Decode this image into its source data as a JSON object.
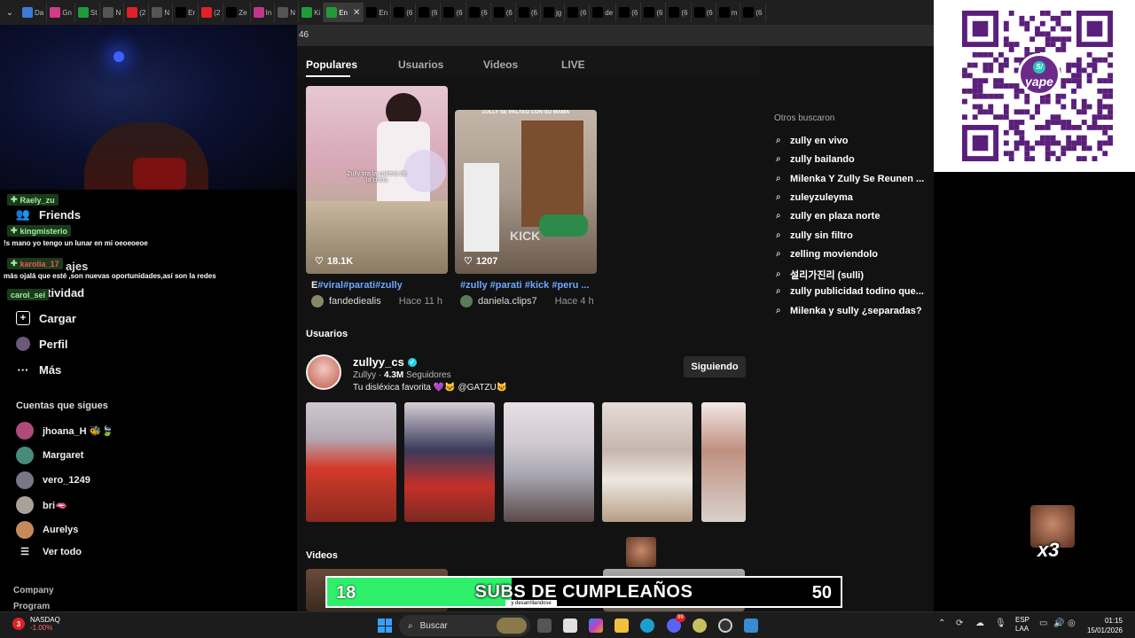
{
  "browser": {
    "tabs": [
      {
        "label": "Da",
        "color": "#3a7bd5"
      },
      {
        "label": "Gn",
        "color": "#d23a8a"
      },
      {
        "label": "St",
        "color": "#1e9c3a"
      },
      {
        "label": "N",
        "color": "#555555"
      },
      {
        "label": "(2",
        "color": "#e0202a"
      },
      {
        "label": "N",
        "color": "#555555"
      },
      {
        "label": "Er",
        "color": "#000000"
      },
      {
        "label": "(2",
        "color": "#e0202a"
      },
      {
        "label": "Ze",
        "color": "#000000"
      },
      {
        "label": "In",
        "color": "#c1358a"
      },
      {
        "label": "N",
        "color": "#555555"
      },
      {
        "label": "Ki",
        "color": "#1e9c3a"
      },
      {
        "label": "En",
        "color": "#1e9c3a"
      },
      {
        "label": "En",
        "color": "#000000"
      },
      {
        "label": "(6",
        "color": "#000000"
      },
      {
        "label": "(6",
        "color": "#000000"
      },
      {
        "label": "(6",
        "color": "#000000"
      },
      {
        "label": "(6",
        "color": "#000000"
      },
      {
        "label": "(6",
        "color": "#000000"
      },
      {
        "label": "(6",
        "color": "#000000"
      },
      {
        "label": "jg",
        "color": "#000000"
      },
      {
        "label": "(6",
        "color": "#000000"
      },
      {
        "label": "de",
        "color": "#000000"
      },
      {
        "label": "(6",
        "color": "#000000"
      },
      {
        "label": "(6",
        "color": "#000000"
      },
      {
        "label": "(6",
        "color": "#000000"
      },
      {
        "label": "(6",
        "color": "#000000"
      },
      {
        "label": "m",
        "color": "#000000"
      },
      {
        "label": "(6",
        "color": "#000000"
      }
    ],
    "active_tab_index": 12,
    "address_fragment": "46"
  },
  "sidebar": {
    "nav": [
      {
        "label": "Friends",
        "icon": "friends-icon",
        "glyph": "👥"
      },
      {
        "label": "Cargar",
        "icon": "upload-icon",
        "glyph": "⊞"
      },
      {
        "label": "Perfil",
        "icon": "profile-icon",
        "glyph": "●"
      },
      {
        "label": "Más",
        "icon": "more-icon",
        "glyph": "···"
      }
    ],
    "partial_labels": [
      "ajes",
      "ctividad"
    ],
    "following_title": "Cuentas que sigues",
    "following": [
      {
        "name": "jhoana_H 🐝🍃",
        "color": "#b04a7a"
      },
      {
        "name": "Margaret",
        "color": "#4a8a7a"
      },
      {
        "name": "vero_1249",
        "color": "#777788"
      },
      {
        "name": "bri🫦",
        "color": "#aaa09a"
      },
      {
        "name": "Aurelys",
        "color": "#c58a5a"
      },
      {
        "name": "Ver todo",
        "color": ""
      }
    ],
    "footer": [
      "Company",
      "Program"
    ]
  },
  "chat": [
    {
      "user": "Raely_zu",
      "color": "#5bd65b",
      "message": ""
    },
    {
      "user": "kingmisterio",
      "color": "#5bd65b",
      "message": "!s mano yo tengo un lunar en mi oeoeoeoe"
    },
    {
      "user": "karolia_17",
      "color": "#e85a5a",
      "message": "más ojalá que esté ,son nuevas oportunidades,así son la redes"
    },
    {
      "user": "carol_sei",
      "color": "#5bd65b",
      "message": ""
    }
  ],
  "main": {
    "tabs": [
      "Populares",
      "Usuarios",
      "Videos",
      "LIVE"
    ],
    "active_tab": "Populares",
    "videos": [
      {
        "likes": "18.1K",
        "overlay_text": "Zully tira la cartera de la china",
        "caption_prefix": "E",
        "caption": "#viral#parati#zully",
        "author": "fandediealis",
        "time": "Hace 11 h"
      },
      {
        "likes": "1207",
        "overlay_top": "ZULLY SE PALTEO CON SU MAMA",
        "watermark": "KICK",
        "caption": "#zully #parati #kick #peru ...",
        "author": "daniela.clips7",
        "time": "Hace 4 h"
      }
    ],
    "users_section": "Usuarios",
    "user": {
      "handle": "zullyy_cs",
      "display": "Zullyy",
      "followers": "4.3M",
      "followers_label": "Seguidores",
      "bio": "Tu disléxica favorita 💜🐱 @GATZU🐱",
      "follow_label": "Siguiendo"
    },
    "videos_section": "Videos"
  },
  "others": {
    "title": "Otros buscaron",
    "items": [
      "zully en vivo",
      "zully bailando",
      "Milenka Y Zully Se Reunen ...",
      "zuleyzuleyma",
      "zully en plaza norte",
      "zully sin filtro",
      "zelling moviendolo",
      "설리가진리 (sulli)",
      "zully publicidad todino que...",
      "Milenka y sully ¿separadas?"
    ]
  },
  "qr": {
    "brand": "yape",
    "badge": "S/"
  },
  "meme": {
    "multiplier": "x3"
  },
  "subs_goal": {
    "current": "18",
    "title": "SUBS DE CUMPLEAÑOS",
    "goal": "50",
    "progress_fraction": 0.36,
    "caption": "y desarrillandose"
  },
  "taskbar": {
    "ticker_badge": "3",
    "ticker_name": "NASDAQ",
    "ticker_change": "-1.00%",
    "search_placeholder": "Buscar",
    "discord_badge": "99",
    "lang_1": "ESP",
    "lang_2": "LAA",
    "time": "01:15",
    "date": "15/01/2026"
  }
}
